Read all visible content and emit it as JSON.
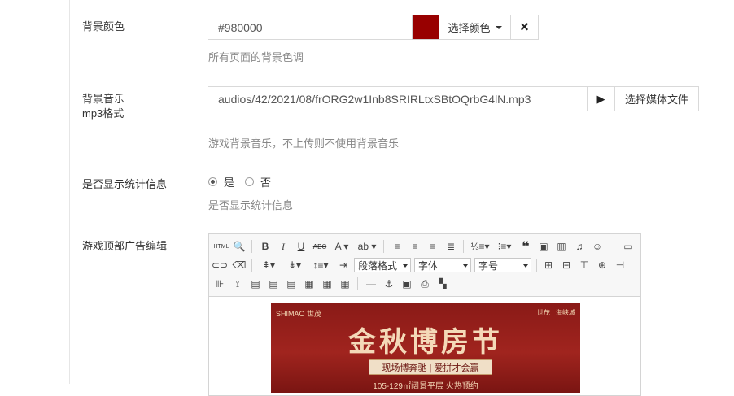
{
  "colors": {
    "swatch": "#980000"
  },
  "bg_color": {
    "label": "背景颜色",
    "value": "#980000",
    "choose_button": "选择颜色",
    "clear_icon": "×",
    "help": "所有页面的背景色调"
  },
  "bg_music": {
    "label_line1": "背景音乐",
    "label_line2": "mp3格式",
    "value": "audios/42/2021/08/frORG2w1Inb8SRIRLtxSBtOQrbG4lN.mp3",
    "play_icon": "▶",
    "choose_button": "选择媒体文件",
    "help": "游戏背景音乐，不上传则不使用背景音乐"
  },
  "show_stats": {
    "label": "是否显示统计信息",
    "option_yes": "是",
    "option_no": "否",
    "help": "是否显示统计信息"
  },
  "ad_editor": {
    "label": "游戏顶部广告编辑",
    "toolbar": {
      "html": "HTML",
      "paragraph": "段落格式",
      "font": "字体",
      "size": "字号"
    },
    "banner": {
      "brand_left": "SHIMAO 世茂",
      "brand_right": "世茂 · 海峡城",
      "title": "金秋博房节",
      "subtitle": "现场博奔驰 | 爱拼才会赢",
      "footer": "105-129㎡阔景平层 火热预约"
    }
  }
}
